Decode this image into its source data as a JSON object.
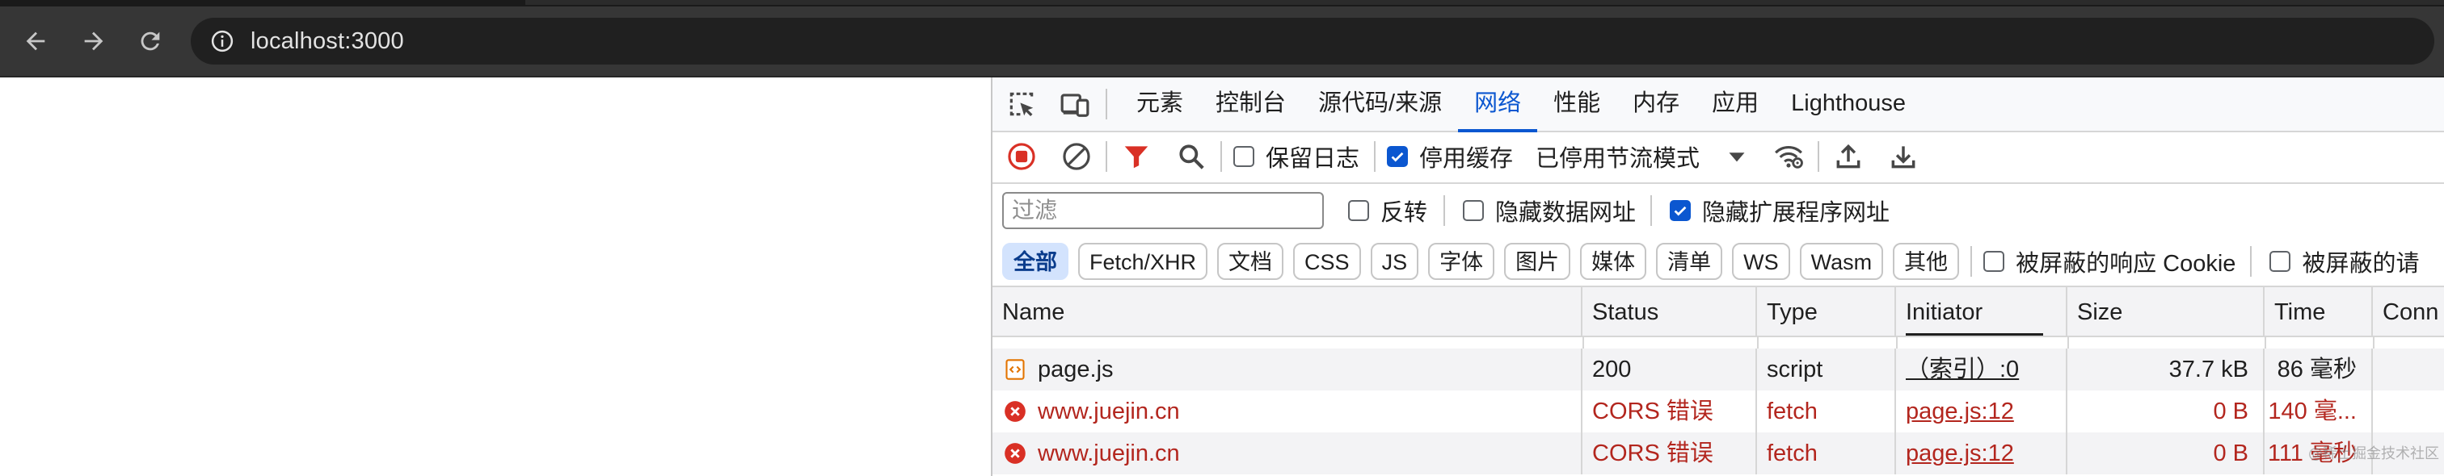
{
  "browser": {
    "url": "localhost:3000"
  },
  "devtools": {
    "tabs": [
      "元素",
      "控制台",
      "源代码/来源",
      "网络",
      "性能",
      "内存",
      "应用",
      "Lighthouse"
    ],
    "active_tab": "网络",
    "network_toolbar": {
      "preserve_log_label": "保留日志",
      "preserve_log_checked": false,
      "disable_cache_label": "停用缓存",
      "disable_cache_checked": true,
      "throttling_value": "已停用节流模式"
    },
    "filter_row": {
      "filter_placeholder": "过滤",
      "invert_label": "反转",
      "invert_checked": false,
      "hide_data_urls_label": "隐藏数据网址",
      "hide_data_urls_checked": false,
      "hide_extension_urls_label": "隐藏扩展程序网址",
      "hide_extension_urls_checked": true
    },
    "type_filters": [
      "全部",
      "Fetch/XHR",
      "文档",
      "CSS",
      "JS",
      "字体",
      "图片",
      "媒体",
      "清单",
      "WS",
      "Wasm",
      "其他"
    ],
    "active_type_filter": "全部",
    "blocked_cookies_label": "被屏蔽的响应 Cookie",
    "blocked_requests_label": "被屏蔽的请",
    "table": {
      "columns": [
        "Name",
        "Status",
        "Type",
        "Initiator",
        "Size",
        "Time",
        "Conn"
      ],
      "rows": [
        {
          "name": "page.js",
          "status": "200",
          "type": "script",
          "initiator": "（索引）:0",
          "size": "37.7 kB",
          "time": "86 毫秒",
          "icon": "script-file-icon",
          "error": false
        },
        {
          "name": "www.juejin.cn",
          "status": "CORS 错误",
          "type": "fetch",
          "initiator": "page.js:12",
          "size": "0 B",
          "time": "140 毫...",
          "icon": "error-icon",
          "error": true
        },
        {
          "name": "www.juejin.cn",
          "status": "CORS 错误",
          "type": "fetch",
          "initiator": "page.js:12",
          "size": "0 B",
          "time": "111 毫秒",
          "icon": "error-icon",
          "error": true
        }
      ]
    },
    "watermark": "@稀土掘金技术社区"
  },
  "colors": {
    "chrome_toolbar": "#363636",
    "accent_blue": "#0b57d0",
    "error_red": "#b3261e",
    "recording_red": "#d93025"
  }
}
